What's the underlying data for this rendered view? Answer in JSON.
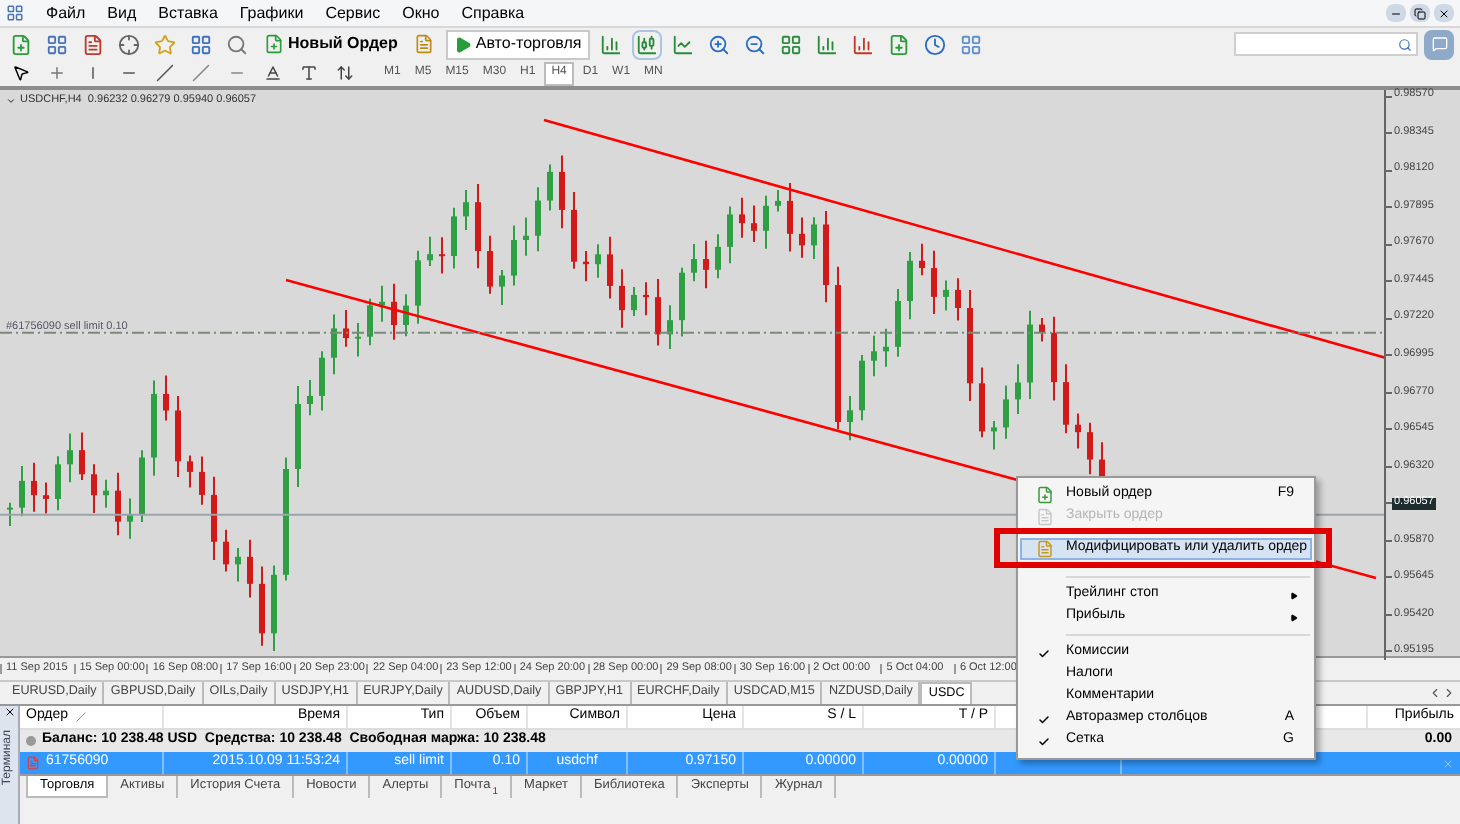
{
  "menu": [
    "Файл",
    "Вид",
    "Вставка",
    "Графики",
    "Сервис",
    "Окно",
    "Справка"
  ],
  "toolbar": {
    "new_order": "Новый Ордер",
    "auto_trading": "Авто-торговля",
    "timeframes": [
      {
        "label": "M1",
        "selected": false
      },
      {
        "label": "M5",
        "selected": false
      },
      {
        "label": "M15",
        "selected": false
      },
      {
        "label": "M30",
        "selected": false
      },
      {
        "label": "H1",
        "selected": false
      },
      {
        "label": "H4",
        "selected": true
      },
      {
        "label": "D1",
        "selected": false
      },
      {
        "label": "W1",
        "selected": false
      },
      {
        "label": "MN",
        "selected": false
      }
    ]
  },
  "chart": {
    "title": "USDCHF,H4  0.96232 0.96279 0.95940 0.96057",
    "order_line_label": "#61756090 sell limit 0.10",
    "price_labels": [
      {
        "text": "0.98570",
        "current": false
      },
      {
        "text": "0.98345",
        "current": false
      },
      {
        "text": "0.98120",
        "current": false
      },
      {
        "text": "0.97895",
        "current": false
      },
      {
        "text": "0.97670",
        "current": false
      },
      {
        "text": "0.97445",
        "current": false
      },
      {
        "text": "0.97220",
        "current": false
      },
      {
        "text": "0.96995",
        "current": false
      },
      {
        "text": "0.96770",
        "current": false
      },
      {
        "text": "0.96545",
        "current": false
      },
      {
        "text": "0.96320",
        "current": false
      },
      {
        "text": "0.96057",
        "current": true
      },
      {
        "text": "0.95870",
        "current": false
      },
      {
        "text": "0.95645",
        "current": false
      },
      {
        "text": "0.95420",
        "current": false
      },
      {
        "text": "0.95195",
        "current": false
      }
    ],
    "time_labels": [
      "11 Sep 2015",
      "15 Sep 00:00",
      "16 Sep 08:00",
      "17 Sep 16:00",
      "20 Sep 23:00",
      "22 Sep 04:00",
      "23 Sep 12:00",
      "24 Sep 20:00",
      "28 Sep 00:00",
      "29 Sep 08:00",
      "30 Sep 16:00",
      "2 Oct 00:00",
      "5 Oct 04:00",
      "6 Oct 12:00"
    ]
  },
  "chart_tabs": [
    {
      "label": "EURUSD,Daily",
      "selected": false
    },
    {
      "label": "GBPUSD,Daily",
      "selected": false
    },
    {
      "label": "OILs,Daily",
      "selected": false
    },
    {
      "label": "USDJPY,H1",
      "selected": false
    },
    {
      "label": "EURJPY,Daily",
      "selected": false
    },
    {
      "label": "AUDUSD,Daily",
      "selected": false
    },
    {
      "label": "GBPJPY,H1",
      "selected": false
    },
    {
      "label": "EURCHF,Daily",
      "selected": false
    },
    {
      "label": "USDCAD,M15",
      "selected": false
    },
    {
      "label": "NZDUSD,Daily",
      "selected": false
    },
    {
      "label": "USDC",
      "selected": true
    }
  ],
  "terminal": {
    "side_label": "Терминал",
    "columns": [
      "Ордер",
      "Время",
      "Тип",
      "Объем",
      "Символ",
      "Цена",
      "S / L",
      "T / P",
      "Прибыль"
    ],
    "balance": "Баланс: 10 238.48 USD  Средства: 10 238.48  Свободная маржа: 10 238.48",
    "balance_profit": "0.00",
    "orders": [
      {
        "cells": [
          "61756090",
          "2015.10.09 11:53:24",
          "sell limit",
          "0.10",
          "usdchf",
          "0.97150",
          "0.00000",
          "0.00000"
        ],
        "selected": true
      }
    ],
    "tabs": [
      {
        "label": "Торговля",
        "selected": true
      },
      {
        "label": "Активы",
        "selected": false
      },
      {
        "label": "История Счета",
        "selected": false
      },
      {
        "label": "Новости",
        "selected": false
      },
      {
        "label": "Алерты",
        "selected": false
      },
      {
        "label": "Почта",
        "selected": false,
        "badge": "1"
      },
      {
        "label": "Маркет",
        "selected": false
      },
      {
        "label": "Библиотека",
        "selected": false
      },
      {
        "label": "Эксперты",
        "selected": false
      },
      {
        "label": "Журнал",
        "selected": false
      }
    ]
  },
  "context_menu": [
    {
      "kind": "item",
      "label": "Новый ордер",
      "shortcut": "F9",
      "disabled": false,
      "highlighted": false,
      "checked": false,
      "submenu": false
    },
    {
      "kind": "item",
      "label": "Закрыть ордер",
      "disabled": true,
      "highlighted": false,
      "checked": false,
      "submenu": false
    },
    {
      "kind": "item",
      "label": "Модифицировать или удалить ордер",
      "disabled": false,
      "highlighted": true,
      "checked": false,
      "submenu": false
    },
    {
      "kind": "separator"
    },
    {
      "kind": "item",
      "label": "Трейлинг стоп",
      "disabled": false,
      "highlighted": false,
      "checked": false,
      "submenu": true
    },
    {
      "kind": "item",
      "label": "Прибыль",
      "disabled": false,
      "highlighted": false,
      "checked": false,
      "submenu": true
    },
    {
      "kind": "separator"
    },
    {
      "kind": "item",
      "label": "Комиссии",
      "disabled": false,
      "highlighted": false,
      "checked": true,
      "submenu": false
    },
    {
      "kind": "item",
      "label": "Налоги",
      "disabled": false,
      "highlighted": false,
      "checked": false,
      "submenu": false
    },
    {
      "kind": "item",
      "label": "Комментарии",
      "disabled": false,
      "highlighted": false,
      "checked": false,
      "submenu": false
    },
    {
      "kind": "item",
      "label": "Авторазмер столбцов",
      "shortcut": "A",
      "disabled": false,
      "highlighted": false,
      "checked": true,
      "submenu": false
    },
    {
      "kind": "item",
      "label": "Сетка",
      "shortcut": "G",
      "disabled": false,
      "highlighted": false,
      "checked": true,
      "submenu": false
    }
  ]
}
